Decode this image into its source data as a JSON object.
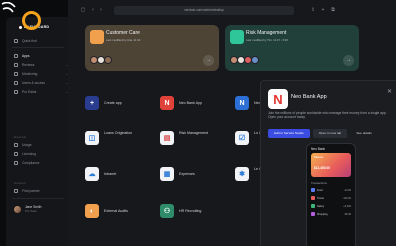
{
  "browser": {
    "url": "vendalo.com/admin/desktop"
  },
  "sidebar": {
    "brand": "DASHBOARD",
    "search": "Quick find",
    "items": [
      {
        "label": "Apps",
        "active": true
      },
      {
        "label": "Reviews"
      },
      {
        "label": "Monitoring"
      },
      {
        "label": "Users & access"
      },
      {
        "label": "Pro Editor"
      }
    ],
    "section_label": "General",
    "lower_items": [
      {
        "label": "Usage"
      },
      {
        "label": "Licensing"
      },
      {
        "label": "Compliance"
      }
    ],
    "account_label": "Account",
    "find_label": "Find partner",
    "user": {
      "name": "Jane Smith",
      "status": "Pro Team"
    }
  },
  "featured": [
    {
      "title": "Customer Care",
      "subtitle": "Last modified by Ana, 11:32",
      "color": "#4e4436"
    },
    {
      "title": "Risk Management",
      "subtitle": "Last modified by Tim, 11:47 - 6:30",
      "color": "#21403a"
    }
  ],
  "apps": [
    {
      "label": "Create app",
      "icon": "plus-icon",
      "bg": "#2a3c8f",
      "glyph": "+"
    },
    {
      "label": "Neo Bank App",
      "icon": "neo-bank-icon",
      "bg": "#e04138",
      "glyph": "N"
    },
    {
      "label": "Neo",
      "icon": "neo-icon",
      "bg": "#e04138",
      "glyph": "N"
    },
    {
      "label": "Loans Origination",
      "icon": "loans-icon",
      "bg": "#f1f3f6",
      "glyph": ""
    },
    {
      "label": "Risk Management",
      "icon": "risk-icon",
      "bg": "#f1f3f6",
      "glyph": ""
    },
    {
      "label": "Lo Co",
      "icon": "check-icon",
      "bg": "#f1f3f6",
      "glyph": ""
    },
    {
      "label": "Intranet",
      "icon": "cloud-icon",
      "bg": "#f1f3f6",
      "glyph": ""
    },
    {
      "label": "Expenses",
      "icon": "doc-icon",
      "bg": "#f1f3f6",
      "glyph": ""
    },
    {
      "label": "Le Ca",
      "icon": "bulb-icon",
      "bg": "#f1f3f6",
      "glyph": ""
    },
    {
      "label": "External Audits",
      "icon": "audit-icon",
      "bg": "#f1a14d",
      "glyph": ""
    },
    {
      "label": "HR Recruiting",
      "icon": "hr-icon",
      "bg": "#2e8c6b",
      "glyph": ""
    }
  ],
  "modal": {
    "title": "Neo Bank App",
    "description": "Join the millions of people worldwide who manage their money from a single app. Open your account today.",
    "buttons": [
      "Edit in Service Studio",
      "Open in new tab",
      "See details"
    ]
  },
  "phone": {
    "header": "Neo Bank",
    "card_label": "Balance",
    "card_amount": "$12,450.00",
    "section": "Transactions",
    "rows": [
      {
        "label": "Food",
        "value": "-24.00",
        "color": "#5a7cf0"
      },
      {
        "label": "Travel",
        "value": "-120.00",
        "color": "#e85b5b"
      },
      {
        "label": "Salary",
        "value": "+3,200",
        "color": "#3fb67d"
      },
      {
        "label": "Shopping",
        "value": "-68.40",
        "color": "#b45ee0"
      }
    ]
  }
}
